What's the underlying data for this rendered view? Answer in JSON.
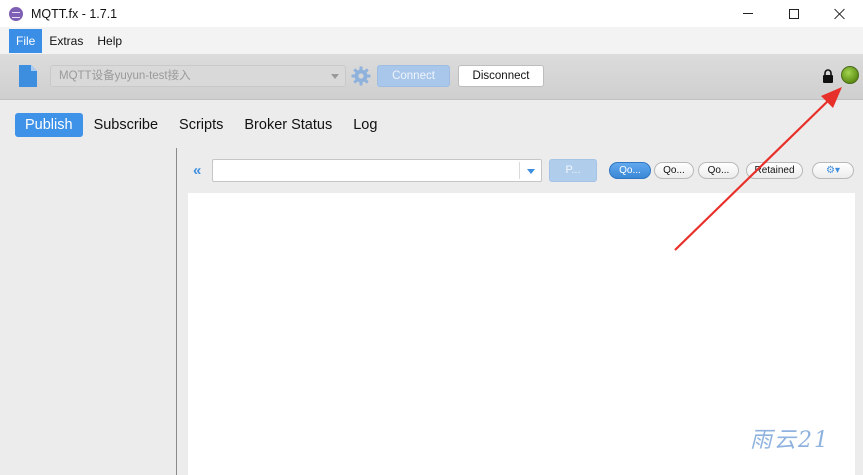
{
  "window": {
    "title": "MQTT.fx - 1.7.1"
  },
  "menu": {
    "items": [
      "File",
      "Extras",
      "Help"
    ]
  },
  "toolbar": {
    "profile_value": "MQTT设备yuyun-test接入",
    "connect_label": "Connect",
    "disconnect_label": "Disconnect",
    "status_led_color": "#6fa31d"
  },
  "tabs": [
    "Publish",
    "Subscribe",
    "Scripts",
    "Broker Status",
    "Log"
  ],
  "publish": {
    "topic_value": "",
    "publish_label": "P...",
    "qos_labels": [
      "Qo...",
      "Qo...",
      "Qo..."
    ],
    "retained_label": "Retained",
    "settings_label": "⚙▾"
  },
  "watermark": "雨云21",
  "colors": {
    "accent": "#3e92e8",
    "annotation_arrow": "#e8302a"
  }
}
